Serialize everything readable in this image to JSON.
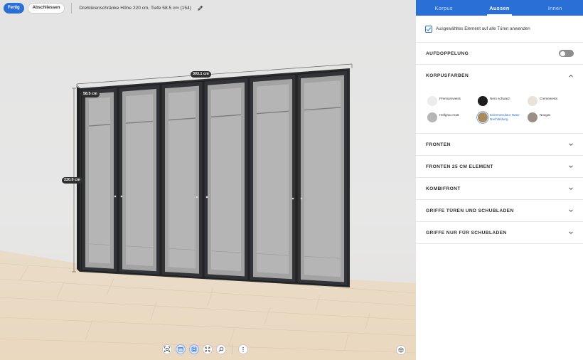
{
  "toolbar": {
    "done_label": "Fertig",
    "finish_label": "Abschliessen",
    "product_title": "Drehtürenschränke Höhe 220 cm, Tiefe 58.5 cm (154)"
  },
  "dimensions": {
    "width": "303.1 cm",
    "depth": "58.5 cm",
    "height": "220.0 cm"
  },
  "view_tools": [
    "fit-view-icon",
    "front-view-icon",
    "top-view-icon",
    "fullscreen-icon",
    "zoom-icon",
    "more-icon"
  ],
  "panel": {
    "tabs": [
      {
        "label": "Korpus",
        "active": false
      },
      {
        "label": "Aussen",
        "active": true
      },
      {
        "label": "Innen",
        "active": false
      }
    ],
    "apply_all": {
      "label": "Ausgewähltes Element auf alle Türen anwenden",
      "checked": true
    },
    "aufdoppelung": {
      "title": "AUFDOPPELUNG",
      "enabled": false
    },
    "korpusfarben": {
      "title": "KORPUSFARBEN",
      "expanded": true,
      "colors": [
        {
          "name": "Premiumweiss",
          "color": "#ececec",
          "selected": false
        },
        {
          "name": "Nero schwarz",
          "color": "#1c1c1c",
          "selected": false
        },
        {
          "name": "Cremeweiss",
          "color": "#e8e4da",
          "selected": false
        },
        {
          "name": "Hellgrau matt",
          "color": "#b5b5b5",
          "selected": false
        },
        {
          "name": "Eichenstruktur Natur Nachbildung",
          "color": "#a88a5e",
          "selected": true
        },
        {
          "name": "Nougat",
          "color": "#9a8f86",
          "selected": false
        }
      ]
    },
    "sections": [
      {
        "title": "FRONTEN"
      },
      {
        "title": "FRONTEN 25 CM ELEMENT"
      },
      {
        "title": "KOMBIFRONT"
      },
      {
        "title": "GRIFFE TÜREN UND SCHUBLADEN"
      },
      {
        "title": "GRIFFE NUR FÜR SCHUBLADEN"
      }
    ]
  },
  "colors": {
    "accent": "#2a6fd6",
    "frame": "#2b2c2e"
  }
}
